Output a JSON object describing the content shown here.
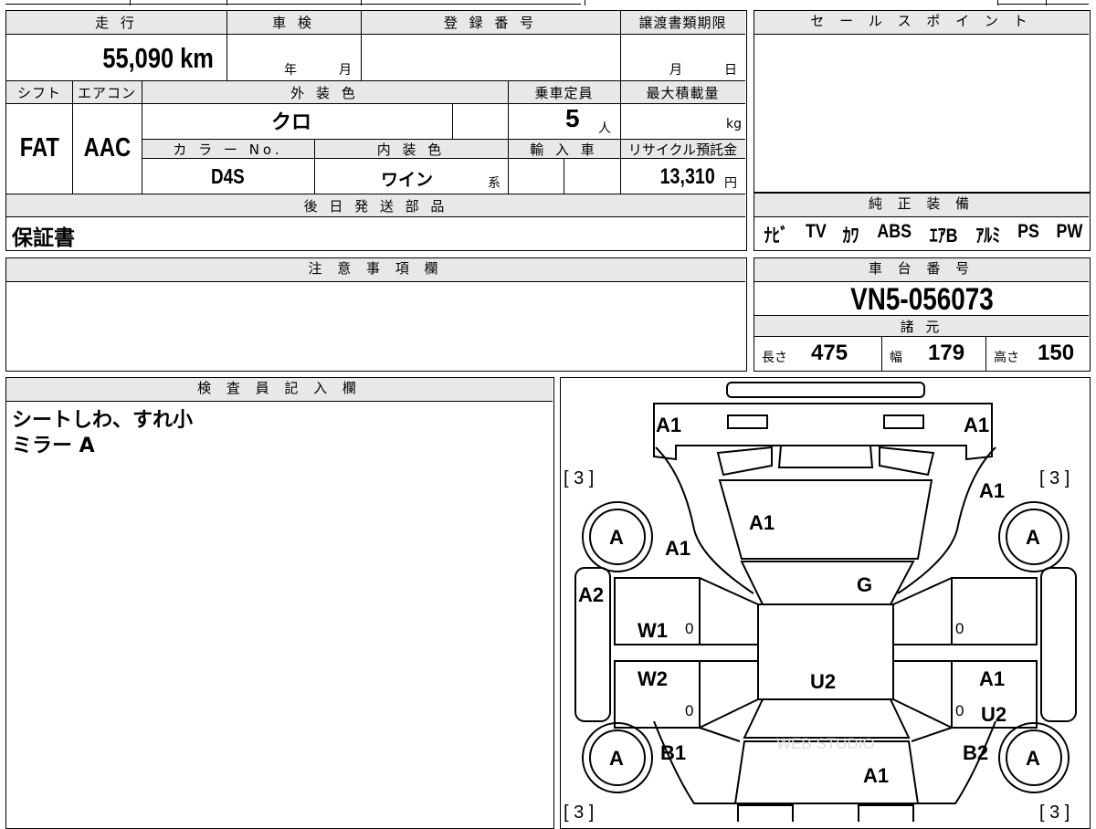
{
  "specs": {
    "mileage_label": "走 行",
    "mileage_value": "55,090 km",
    "inspection_label": "車 検",
    "inspection_year": "年",
    "inspection_month": "月",
    "registration_label": "登 録 番 号",
    "transfer_label": "譲渡書類期限",
    "transfer_month": "月",
    "transfer_day": "日",
    "shift_label": "シフト",
    "shift_value": "FAT",
    "aircon_label": "エアコン",
    "aircon_value": "AAC",
    "exterior_label": "外 装 色",
    "exterior_value": "クロ",
    "capacity_label": "乗車定員",
    "capacity_value": "5",
    "capacity_unit": "人",
    "maxload_label": "最大積載量",
    "maxload_unit": "kg",
    "color_no_label": "カ ラ ー No.",
    "color_no_value": "D4S",
    "interior_label": "内 装 色",
    "interior_value": "ワイン",
    "interior_suffix": "系",
    "import_label": "輸 入 車",
    "recycle_label": "リサイクル預託金",
    "recycle_value": "13,310",
    "recycle_unit": "円",
    "later_parts_label": "後 日 発 送 部 品",
    "later_parts_value": "保証書"
  },
  "sales_point": {
    "label": "セ ー ル ス ポ イ ン ト"
  },
  "equipment": {
    "label": "純 正 装 備",
    "items": [
      "ﾅﾋﾞ",
      "TV",
      "ｶﾜ",
      "ABS",
      "ｴｱB",
      "ｱﾙﾐ",
      "PS",
      "PW"
    ]
  },
  "notes": {
    "label": "注 意 事 項 欄"
  },
  "chassis": {
    "label": "車 台 番 号",
    "value": "VN5-056073"
  },
  "dimensions": {
    "label": "諸 元",
    "length_label": "長さ",
    "length_value": "475",
    "width_label": "幅",
    "width_value": "179",
    "height_label": "高さ",
    "height_value": "150"
  },
  "inspector": {
    "label": "検 査 員 記 入 欄",
    "line1": "シートしわ、すれ小",
    "line2": "ミラー A"
  },
  "diagram": {
    "codes": {
      "front_left": "A1",
      "front_right": "A1",
      "hood": "A1",
      "fender_left": "A1",
      "fender_right": "A1",
      "windshield": "G",
      "pillar_left": "A2",
      "door_fl": "W1",
      "door_rl": "W2",
      "roof": "U2",
      "door_rr": "A1",
      "door_rr2": "U2",
      "quarter_left": "B1",
      "quarter_right": "B2",
      "trunk": "A1",
      "tire_fl": "A",
      "tire_fr": "A",
      "tire_rl": "A",
      "tire_rr": "A"
    },
    "zeros": [
      "0",
      "0",
      "0",
      "0"
    ],
    "tread_fl": "[ 3 ]",
    "tread_fr": "[ 3 ]",
    "tread_rl": "[ 3 ]",
    "tread_rr": "[ 3 ]",
    "watermark": "WEB STUDIO"
  }
}
